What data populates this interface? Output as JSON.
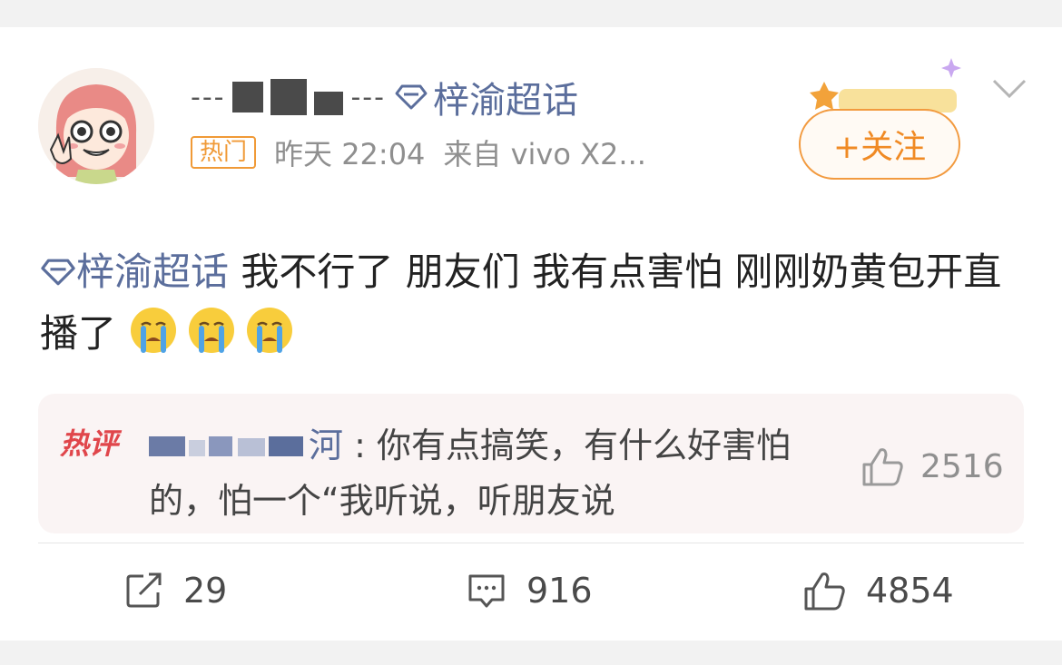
{
  "post": {
    "username_visible": "---",
    "topic_tag": "梓渝超话",
    "hot_badge": "热门",
    "time": "昨天 22:04",
    "source": "来自 vivo X2...",
    "follow_label": "+关注",
    "text_topic": "梓渝超话",
    "text": " 我不行了  朋友们  我有点害怕  刚刚奶黄包开直播了",
    "emojis": [
      "crying-face-emoji",
      "crying-face-emoji",
      "crying-face-emoji"
    ]
  },
  "hot_comment": {
    "label": "热评",
    "commenter_visible": "河",
    "text": ": 你有点搞笑，有什么好害怕的，怕一个“我听说，听朋友说",
    "likes": "2516"
  },
  "actions": {
    "repost": "29",
    "comments": "916",
    "likes": "4854"
  },
  "colors": {
    "topic_link": "#5b6e9c",
    "hot_badge": "#f09a37",
    "follow_button": "#f08a24",
    "hot_comment_bg": "#faf4f4",
    "hot_label": "#e0464b"
  }
}
